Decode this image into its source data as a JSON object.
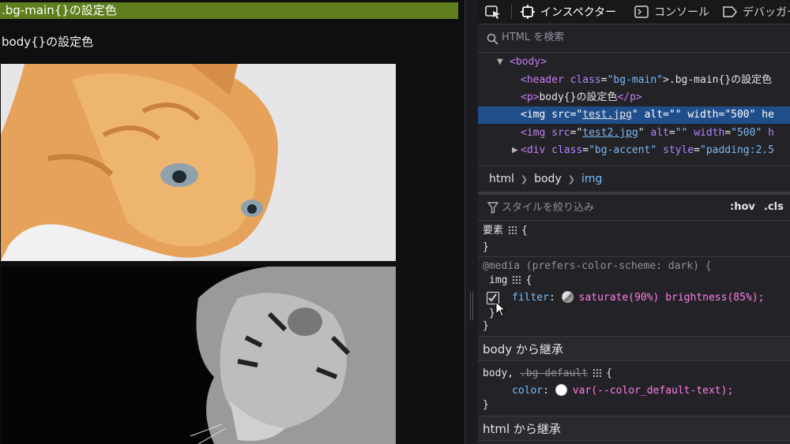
{
  "page": {
    "header_text": ".bg-main{}の設定色",
    "paragraph_text": "body{}の設定色",
    "header_bg": "#5f7f1e",
    "page_bg": "#0f0f0f"
  },
  "devtools": {
    "toolbar": {
      "inspector": "インスペクター",
      "console": "コンソール",
      "debugger": "デバッガー"
    },
    "search_placeholder": "HTML を検索",
    "markup": {
      "body_open": "<body>",
      "header_tag_open": "<header",
      "header_attr_class": "class",
      "header_attr_class_val": "\"bg-main\"",
      "header_text": ">.bg-main{}の設定色",
      "p_line_open": "<p>",
      "p_line_text": "body{}の設定色",
      "p_line_close": "</p>",
      "img1_tag": "<img",
      "img1_src_name": "src",
      "img1_src_val": "test.jpg",
      "img1_alt": "alt",
      "img1_alt_val": "\"\"",
      "img1_width": "width",
      "img1_width_val": "\"500\"",
      "img1_tail": "he",
      "img2_tag": "<img",
      "img2_src_name": "src",
      "img2_src_val": "test2.jpg",
      "img2_alt": "alt",
      "img2_alt_val": "\"\"",
      "img2_width": "width",
      "img2_width_val": "\"500\"",
      "img2_tail": "h",
      "div_tag": "<div",
      "div_class": "class",
      "div_class_val": "\"bg-accent\"",
      "div_style": "style",
      "div_style_val": "\"padding:2.5"
    },
    "breadcrumbs": [
      "html",
      "body",
      "img"
    ],
    "filter_placeholder": "スタイルを絞り込み",
    "hov_label": ":hov",
    "cls_label": ".cls",
    "rules": {
      "element_selector": "要素",
      "media_query": "@media (prefers-color-scheme: dark) {",
      "img_selector": "img",
      "filter_prop": "filter",
      "filter_value": "saturate(90%) brightness(85%);",
      "inherit_body": "body から継承",
      "body_selector": "body,",
      "body_selector_struck": ".bg-default",
      "color_prop": "color",
      "color_value": "var(--color_default-text);",
      "inherit_html": "html から継承",
      "open_brace": "{",
      "close_brace": "}"
    }
  }
}
